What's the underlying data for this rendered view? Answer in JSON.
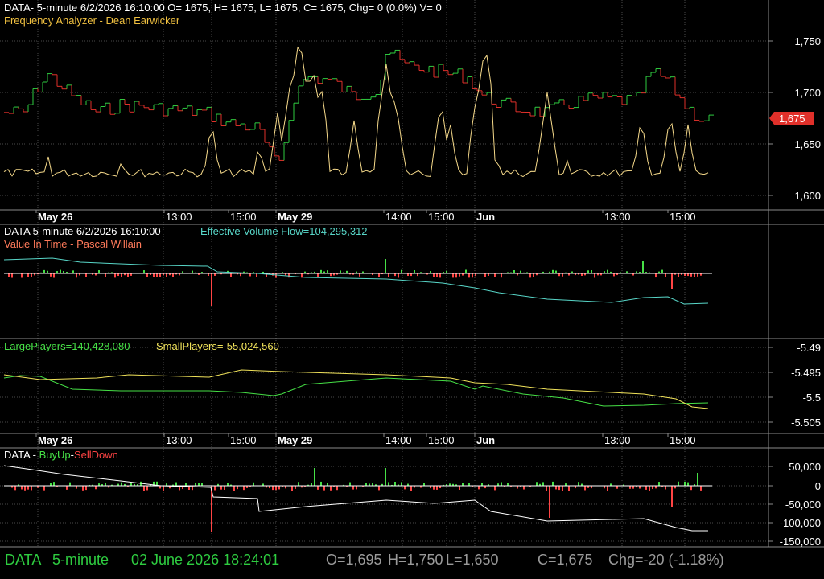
{
  "colors": {
    "background": "#000000",
    "grid": "#4a4a4a",
    "axis_text": "#ffffff",
    "price_up": "#2ecc40",
    "price_down": "#e0302a",
    "frequency": "#f5d98a",
    "evf": "#58d6c8",
    "vit": "#ff7a5a",
    "large_players": "#46e046",
    "small_players": "#f0e25a",
    "buyup": "#46e046",
    "selldown": "#ff4444",
    "last_price_tag": "#e0302a",
    "status_green": "#2ecc40",
    "status_gray": "#9a9a9a"
  },
  "panel1": {
    "header": "DATA- 5-minute 6/2/2026 16:10:00 O= 1675, H= 1675, L= 1675, C= 1675, Chg= 0 (0.0%) V= 0",
    "subheader": "Frequency Analyzer - Dean Earwicker",
    "y_ticks": [
      "1,750",
      "1,700",
      "1,650",
      "1,600"
    ],
    "last_price": "1,675"
  },
  "time_axis": {
    "labels": [
      "May 26",
      "13:00",
      "15:00",
      "May 29",
      "14:00",
      "15:00",
      "Jun",
      "13:00",
      "15:00"
    ],
    "bold": [
      true,
      false,
      false,
      true,
      false,
      false,
      true,
      false,
      false
    ]
  },
  "panel2": {
    "header_left": "DATA 5-minute  6/2/2026 16:10:00",
    "header_right": "Effective Volume Flow=104,295,312",
    "subheader": "Value In Time - Pascal Willain"
  },
  "panel3": {
    "large_label": "LargePlayers=140,428,080",
    "small_label": "SmallPlayers=-55,024,560",
    "y_ticks": [
      "-5.49",
      "-5.495",
      "-5.5",
      "-5.505"
    ]
  },
  "panel4": {
    "prefix": "DATA - ",
    "buy_label": "BuyUp",
    "dash": "-",
    "sell_label": "SellDown",
    "y_ticks": [
      "50,000",
      "0",
      "-50,000",
      "-100,000",
      "-150,000"
    ]
  },
  "status": {
    "symbol": "DATA",
    "interval": "5-minute",
    "datetime": "02 June 2026 18:24:01",
    "open": "O=1,695",
    "high": "H=1,750",
    "low": "L=1,650",
    "close": "C=1,675",
    "change": "Chg=-20 (-1.18%)"
  }
}
